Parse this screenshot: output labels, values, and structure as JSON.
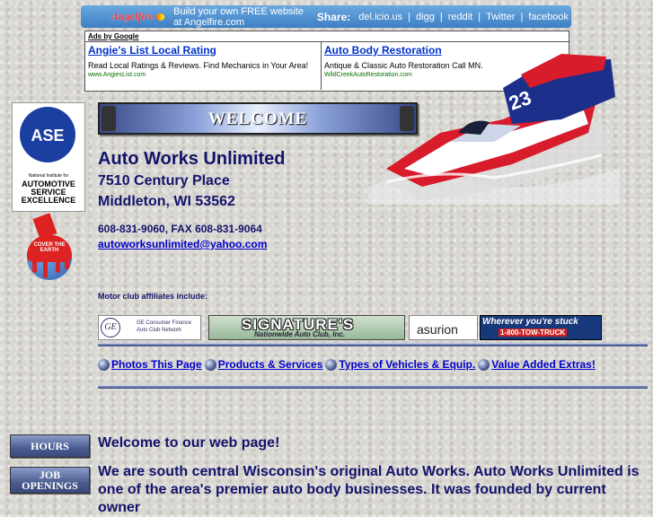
{
  "topbar": {
    "logo": "Angelfire",
    "build_text": "Build your own FREE website at Angelfire.com",
    "share_label": "Share:",
    "share_links": [
      "del.icio.us",
      "digg",
      "reddit",
      "Twitter",
      "facebook"
    ],
    "separator": "|"
  },
  "ads": {
    "header": "Ads by Google",
    "items": [
      {
        "title": "Angie's List Local Rating",
        "description": "Read Local Ratings & Reviews. Find Mechanics in Your Area!",
        "url": "www.AngiesList.com"
      },
      {
        "title": "Auto Body Restoration",
        "description": "Antique & Classic Auto Restoration Call MN.",
        "url": "WildCreekAutoRestoration.com"
      }
    ]
  },
  "logos": {
    "ase": {
      "letters": "ASE",
      "small": "National Institute for",
      "big": [
        "AUTOMOTIVE",
        "SERVICE",
        "EXCELLENCE"
      ]
    },
    "sherwin": {
      "text": "COVER THE EARTH"
    }
  },
  "banner": {
    "welcome": "WELCOME"
  },
  "company": {
    "name": "Auto Works Unlimited",
    "address1": "7510 Century Place",
    "address2": "Middleton, WI 53562",
    "phone": "608-831-9060, FAX 608-831-9064",
    "email": "autoworksunlimited@yahoo.com",
    "motor_club_label": "Motor club affiliates include:"
  },
  "affiliates": {
    "ge": {
      "mark": "GE",
      "text": "GE Consumer Finance Auto Club Network"
    },
    "signature": {
      "name": "SIGNATURE'S",
      "sub": "Nationwide Auto Club, Inc."
    },
    "asurion": "asurion",
    "tow": {
      "slogan": "Wherever you're stuck",
      "number": "1-800-TOW-TRUCK"
    }
  },
  "nav": [
    {
      "label": "Photos This Page"
    },
    {
      "label": "Products & Services"
    },
    {
      "label": "Types of Vehicles & Equip."
    },
    {
      "label": "Value Added Extras!"
    }
  ],
  "sidebar_buttons": {
    "hours": "HOURS",
    "jobs": "JOB OPENINGS"
  },
  "content": {
    "welcome_message": "Welcome to our web page!",
    "intro": "We are south central Wisconsin's original Auto Works. Auto Works Unlimited is one of the area's premier auto body businesses. It was founded by current owner"
  },
  "colors": {
    "text_navy": "#13136b",
    "link": "#0000cc",
    "topbar": "#3d7fc4"
  }
}
